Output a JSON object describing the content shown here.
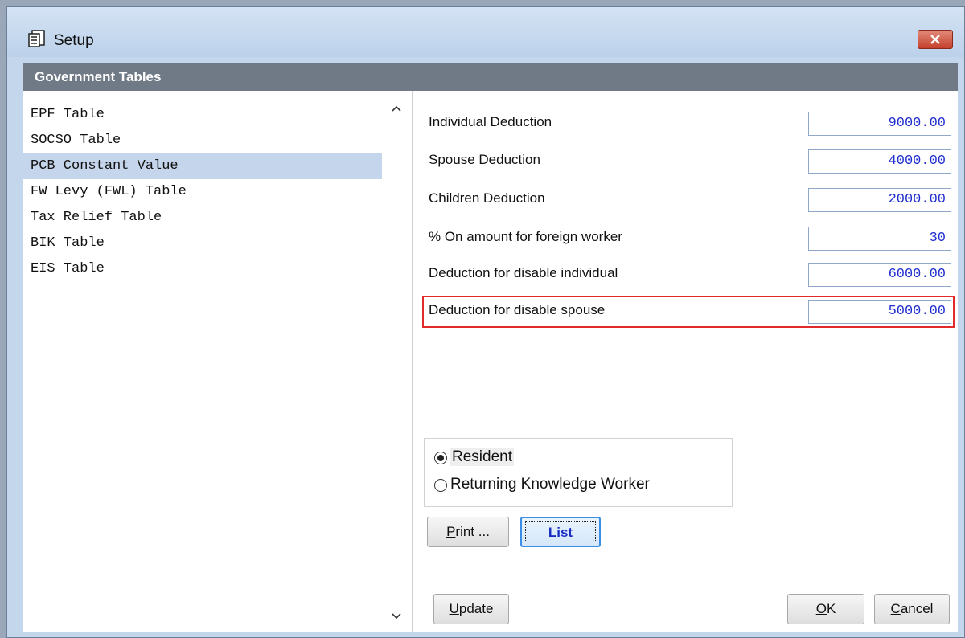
{
  "window": {
    "title": "Setup",
    "icon": "setup-app-icon"
  },
  "header": {
    "title": "Government Tables"
  },
  "list": {
    "items": [
      {
        "label": "EPF Table"
      },
      {
        "label": "SOCSO Table"
      },
      {
        "label": "PCB Constant Value",
        "selected": true
      },
      {
        "label": "FW Levy (FWL) Table"
      },
      {
        "label": "Tax Relief Table"
      },
      {
        "label": "BIK Table"
      },
      {
        "label": "EIS Table"
      }
    ]
  },
  "fields": [
    {
      "label": "Individual Deduction",
      "value": "9000.00"
    },
    {
      "label": "Spouse Deduction",
      "value": "4000.00"
    },
    {
      "label": "Children Deduction",
      "value": "2000.00"
    },
    {
      "label": "% On amount for foreign worker",
      "value": "30"
    },
    {
      "label": "Deduction for disable individual",
      "value": "6000.00"
    },
    {
      "label": "Deduction for disable spouse",
      "value": "5000.00"
    }
  ],
  "radios": [
    {
      "label": "Resident",
      "checked": true
    },
    {
      "label": "Returning Knowledge Worker",
      "checked": false
    }
  ],
  "buttons": {
    "print_accel": "P",
    "print_rest": "rint ...",
    "list_label": "List",
    "update_accel": "U",
    "update_rest": "pdate",
    "ok_accel": "O",
    "ok_rest": "K",
    "cancel_accel": "C",
    "cancel_rest": "ancel"
  },
  "colors": {
    "accent": "#3a8ee6",
    "highlight": "#e32a2a",
    "value_text": "#1f2fcf",
    "header_bg": "#707a86"
  }
}
